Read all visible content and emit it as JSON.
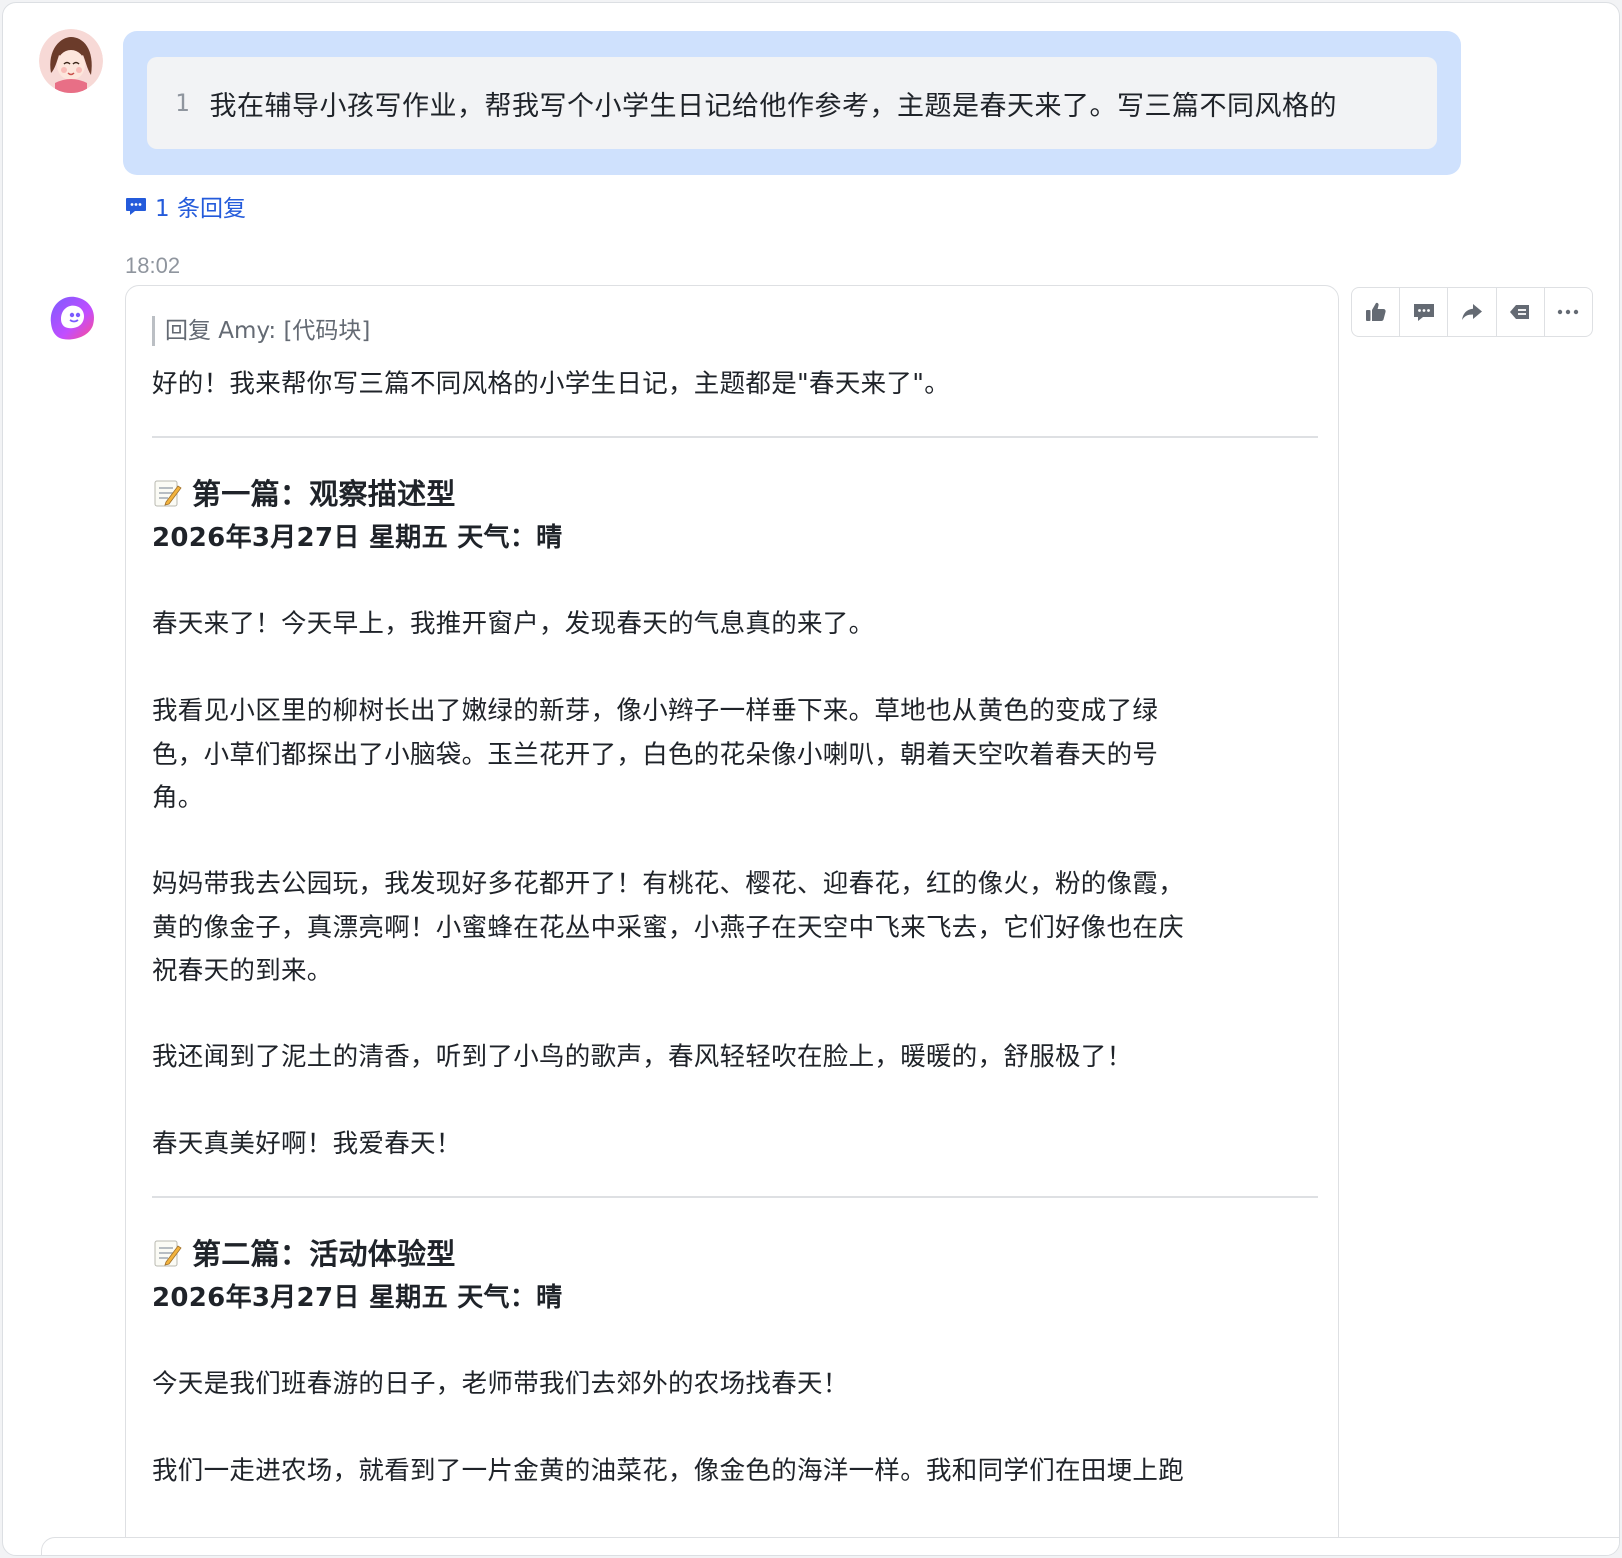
{
  "thread": {
    "user": {
      "name": "Amy",
      "quote_line_number": "1",
      "quote_text": "我在辅导小孩写作业，帮我写个小学生日记给他作参考，主题是春天来了。写三篇不同风格的"
    },
    "reply_count_label": "1 条回复",
    "timestamp": "18:02"
  },
  "bot_message": {
    "reply_ref": "回复 Amy: [代码块]",
    "intro": "好的！我来帮你写三篇不同风格的小学生日记，主题都是\"春天来了\"。",
    "entry1": {
      "heading": "第一篇：观察描述型",
      "date": "2026年3月27日 星期五 天气：晴",
      "p1": "春天来了！今天早上，我推开窗户，发现春天的气息真的来了。",
      "p2_l1": "我看见小区里的柳树长出了嫩绿的新芽，像小辫子一样垂下来。草地也从黄色的变成了绿",
      "p2_l2": "色，小草们都探出了小脑袋。玉兰花开了，白色的花朵像小喇叭，朝着天空吹着春天的号",
      "p2_l3": "角。",
      "p3_l1": "妈妈带我去公园玩，我发现好多花都开了！有桃花、樱花、迎春花，红的像火，粉的像霞，",
      "p3_l2": "黄的像金子，真漂亮啊！小蜜蜂在花丛中采蜜，小燕子在天空中飞来飞去，它们好像也在庆",
      "p3_l3": "祝春天的到来。",
      "p4": "我还闻到了泥土的清香，听到了小鸟的歌声，春风轻轻吹在脸上，暖暖的，舒服极了！",
      "p5": "春天真美好啊！我爱春天！"
    },
    "entry2": {
      "heading": "第二篇：活动体验型",
      "date": "2026年3月27日 星期五 天气：晴",
      "p1": "今天是我们班春游的日子，老师带我们去郊外的农场找春天！",
      "p2_l1": "我们一走进农场，就看到了一片金黄的油菜花，像金色的海洋一样。我和同学们在田埂上跑"
    }
  },
  "actions": {
    "icons": [
      "thumbs-up-icon",
      "comment-icon",
      "forward-icon",
      "quote-reply-icon",
      "more-icon"
    ]
  },
  "colors": {
    "accent": "#245bdb",
    "quote_bubble": "#cfe1fd",
    "quote_inner": "#f2f3f5",
    "icon_gray": "#646a73",
    "border": "#dee0e3"
  }
}
